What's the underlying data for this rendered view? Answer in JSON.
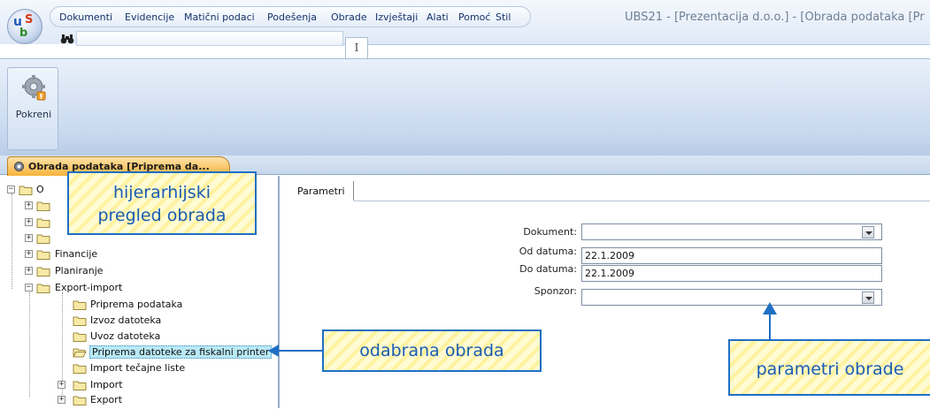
{
  "menu": {
    "items": [
      "Dokumenti",
      "Evidencije",
      "Matični podaci",
      "Podešenja",
      "Obrade",
      "Izvještaji",
      "Alati",
      "Pomoć",
      "Stil"
    ]
  },
  "window": {
    "title": "UBS21 - [Prezentacija d.o.o.] - [Obrada podataka [Pr"
  },
  "app_logo": {
    "u": "u",
    "b": "b",
    "s": "S"
  },
  "ribbon": {
    "tab_label": "I",
    "run_button_label": "Pokreni"
  },
  "doc_tab": {
    "label": "Obrada podataka [Priprema da..."
  },
  "tree": {
    "root": "O",
    "nodes": [
      {
        "label": "Financije"
      },
      {
        "label": "Planiranje"
      },
      {
        "label": "Export-import"
      },
      {
        "label": "Priprema podataka"
      },
      {
        "label": "Izvoz datoteka"
      },
      {
        "label": "Uvoz datoteka"
      },
      {
        "label": "Priprema datoteke za fiskalni printer"
      },
      {
        "label": "Import tečajne liste"
      },
      {
        "label": "Import"
      },
      {
        "label": "Export"
      }
    ]
  },
  "params": {
    "tab_label": "Parametri",
    "dokument_label": "Dokument:",
    "dokument_value": "",
    "od_datuma_label": "Od datuma:",
    "od_datuma_value": "22.1.2009",
    "do_datuma_label": "Do datuma:",
    "do_datuma_value": "22.1.2009",
    "sponzor_label": "Sponzor:",
    "sponzor_value": ""
  },
  "callouts": {
    "tree_line1": "hijerarhijski",
    "tree_line2": "pregled obrada",
    "selected": "odabrana obrada",
    "params": "parametri obrade"
  },
  "colors": {
    "callout_border": "#1f6fc4",
    "callout_fill": "#fff6b0",
    "doc_tab": "#f7b33b",
    "selection": "#b9e9f7"
  }
}
